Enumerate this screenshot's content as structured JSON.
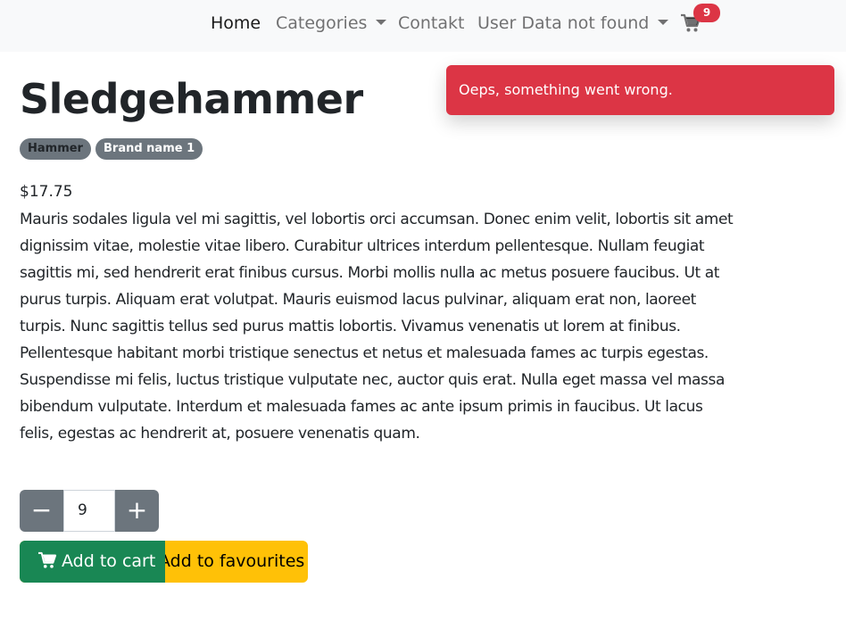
{
  "nav": {
    "home": "Home",
    "categories": "Categories",
    "contact": "Contakt",
    "user": "User Data not found",
    "cart_count": "9"
  },
  "toast": {
    "message": "Oeps, something went wrong."
  },
  "product": {
    "title": "Sledgehammer",
    "tags": [
      "Hammer",
      "Brand name 1"
    ],
    "price": "$17.75",
    "description": "Mauris sodales ligula vel mi sagittis, vel lobortis orci accumsan. Donec enim velit, lobortis sit amet dignissim vitae, molestie vitae libero. Curabitur ultrices interdum pellentesque. Nullam feugiat sagittis mi, sed hendrerit erat finibus cursus. Morbi mollis nulla ac metus posuere faucibus. Ut at purus turpis. Aliquam erat volutpat. Mauris euismod lacus pulvinar, aliquam erat non, laoreet turpis. Nunc sagittis tellus sed purus mattis lobortis. Vivamus venenatis ut lorem at finibus. Pellentesque habitant morbi tristique senectus et netus et malesuada fames ac turpis egestas. Suspendisse mi felis, luctus tristique vulputate nec, auctor quis erat. Nulla eget massa vel massa bibendum vulputate. Interdum et malesuada fames ac ante ipsum primis in faucibus. Ut lacus felis, egestas ac hendrerit at, posuere venenatis quam."
  },
  "quantity": {
    "value": "9",
    "minus": "−",
    "plus": "+"
  },
  "actions": {
    "add_to_cart": "Add to cart",
    "add_to_favourites": "Add to favourites"
  },
  "colors": {
    "danger": "#dc3545",
    "success": "#198754",
    "warning": "#ffc107",
    "secondary": "#6c757d",
    "navbar_bg": "#f8f9fa"
  },
  "icons": {
    "nav_cart": "cart-icon",
    "button_cart": "cart-icon",
    "dropdown": "chevron-down-icon"
  }
}
